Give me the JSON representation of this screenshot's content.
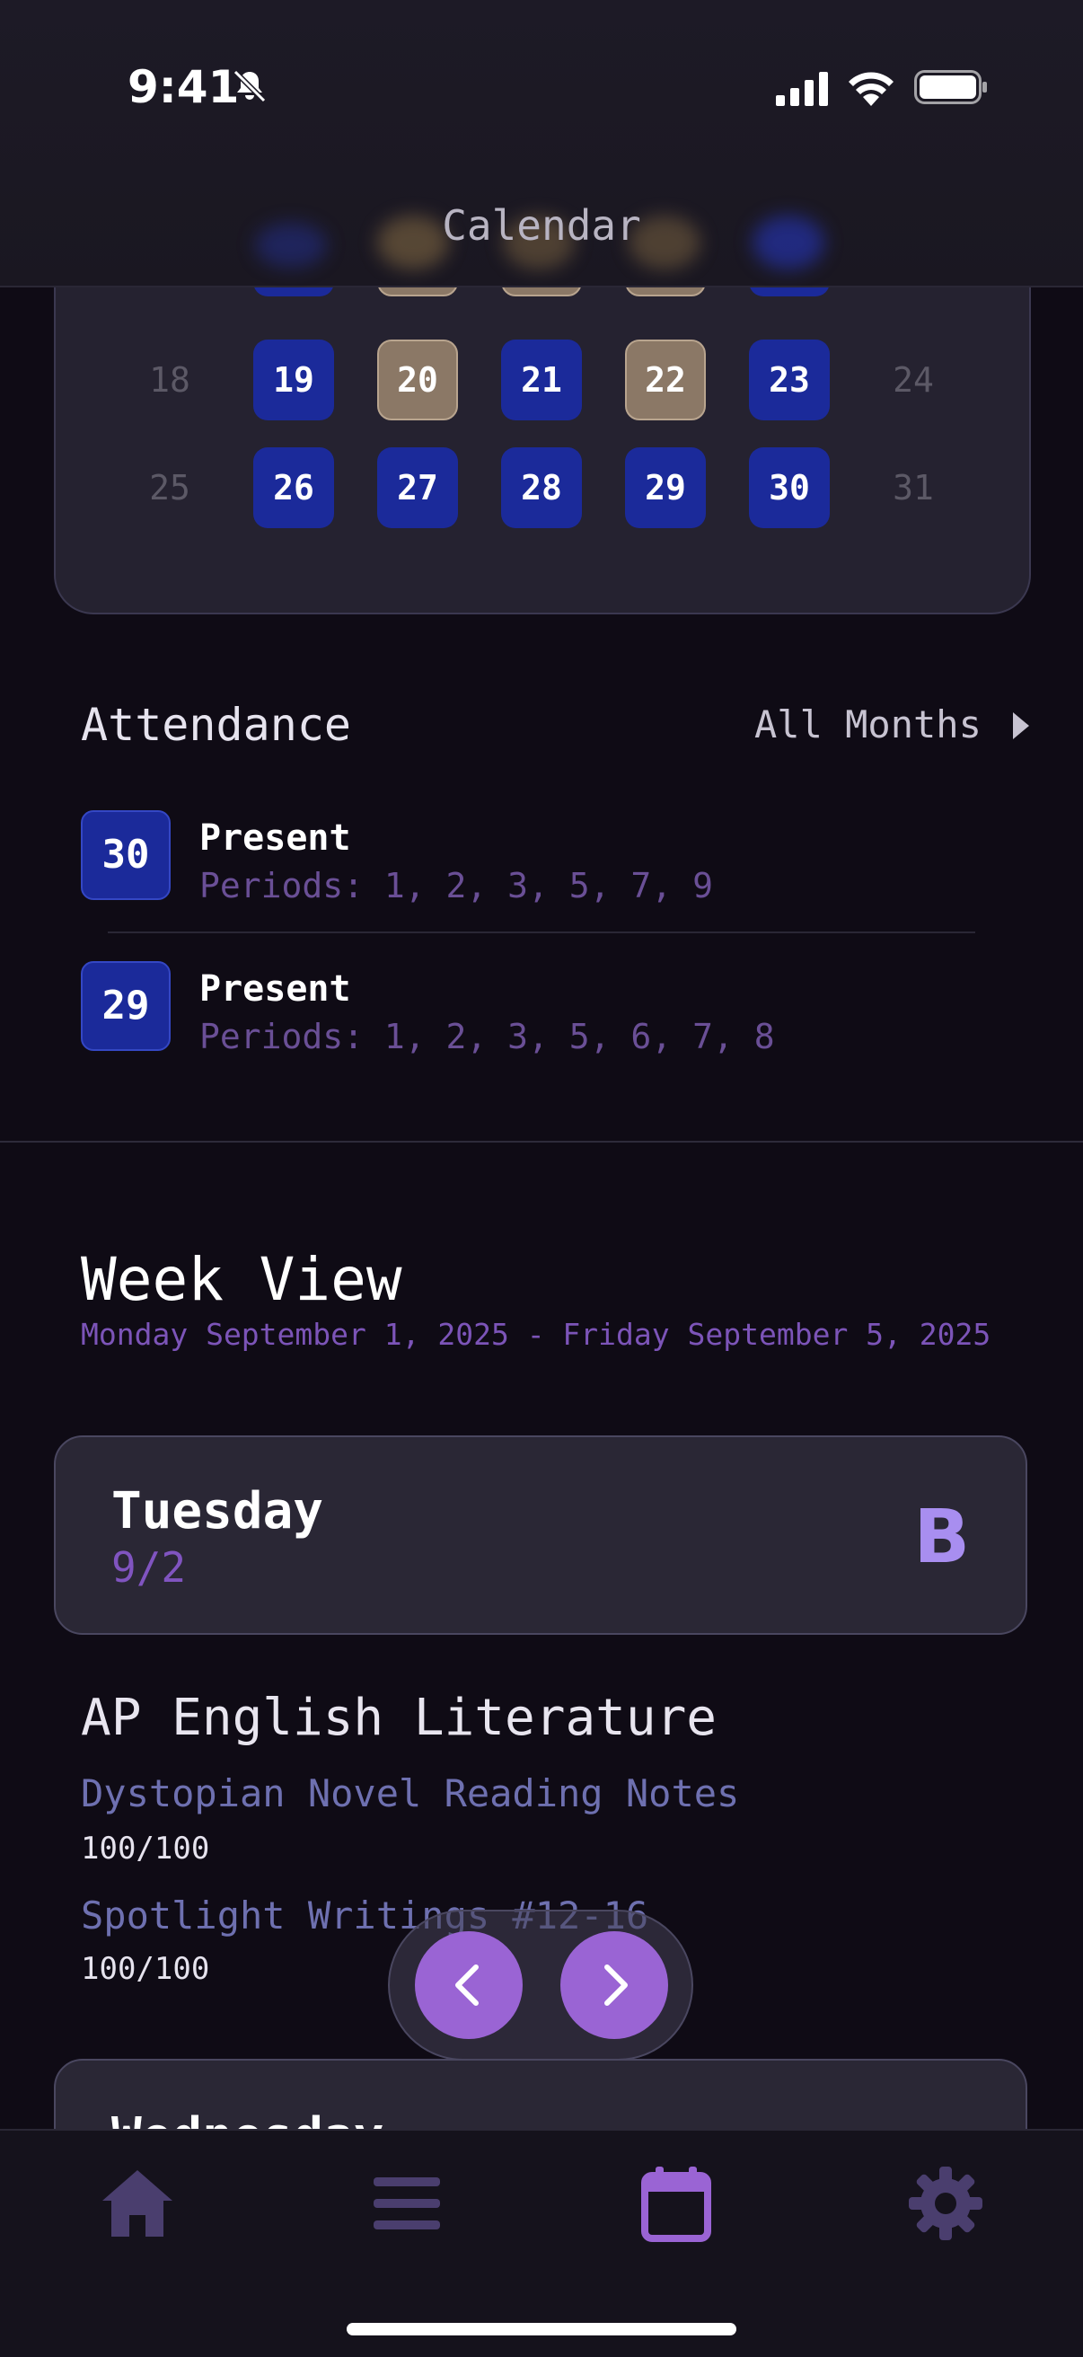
{
  "status_bar": {
    "time": "9:41",
    "icons": [
      "bell-slash-icon",
      "signal-icon",
      "wifi-icon",
      "battery-icon"
    ]
  },
  "header": {
    "title": "Calendar"
  },
  "calendar": {
    "rows": [
      [
        {
          "day": "18",
          "type": "weekend"
        },
        {
          "day": "19",
          "type": "school"
        },
        {
          "day": "20",
          "type": "off"
        },
        {
          "day": "21",
          "type": "school"
        },
        {
          "day": "22",
          "type": "off"
        },
        {
          "day": "23",
          "type": "school"
        },
        {
          "day": "24",
          "type": "weekend"
        }
      ],
      [
        {
          "day": "25",
          "type": "weekend"
        },
        {
          "day": "26",
          "type": "school"
        },
        {
          "day": "27",
          "type": "school"
        },
        {
          "day": "28",
          "type": "school"
        },
        {
          "day": "29",
          "type": "school"
        },
        {
          "day": "30",
          "type": "school"
        },
        {
          "day": "31",
          "type": "weekend"
        }
      ]
    ],
    "colors": {
      "school": "#1b2a9a",
      "off": "#8b7866"
    }
  },
  "attendance": {
    "title": "Attendance",
    "all_months_label": "All Months",
    "records": [
      {
        "day": "30",
        "status": "Present",
        "periods": "Periods: 1, 2, 3, 5, 7, 9"
      },
      {
        "day": "29",
        "status": "Present",
        "periods": "Periods: 1, 2, 3, 5, 6, 7, 8"
      }
    ]
  },
  "week_view": {
    "title": "Week View",
    "range": "Monday September 1, 2025 - Friday September 5, 2025",
    "days": [
      {
        "name": "Tuesday",
        "date": "9/2",
        "letter": "B",
        "classes": [
          {
            "name": "AP English Literature",
            "assignments": [
              {
                "title": "Dystopian Novel Reading Notes",
                "score": "100/100"
              },
              {
                "title": "Spotlight Writings #12-16",
                "score": "100/100"
              }
            ]
          }
        ]
      },
      {
        "name": "Wednesday"
      }
    ]
  },
  "nav_pill": {
    "icons": [
      "chevron-left-icon",
      "chevron-right-icon"
    ],
    "color": "#9a64d4"
  },
  "tab_bar": {
    "tabs": [
      "home-icon",
      "list-icon",
      "calendar-icon",
      "settings-icon"
    ],
    "active": "calendar-icon",
    "active_color": "#9a64d4",
    "inactive_color": "#4a3e6e"
  }
}
